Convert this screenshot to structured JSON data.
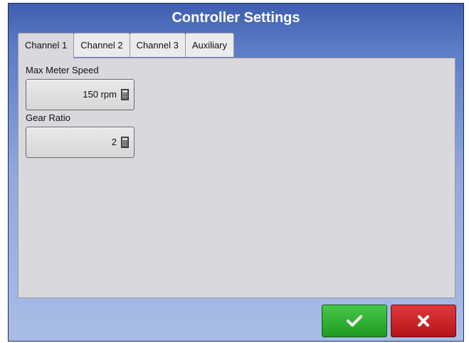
{
  "dialog": {
    "title": "Controller Settings"
  },
  "tabs": [
    {
      "label": "Channel 1",
      "active": true
    },
    {
      "label": "Channel 2",
      "active": false
    },
    {
      "label": "Channel 3",
      "active": false
    },
    {
      "label": "Auxiliary",
      "active": false
    }
  ],
  "fields": {
    "max_meter_speed": {
      "label": "Max Meter Speed",
      "value": "150 rpm",
      "icon": "calculator-icon"
    },
    "gear_ratio": {
      "label": "Gear Ratio",
      "value": "2",
      "icon": "calculator-icon"
    }
  },
  "buttons": {
    "ok": {
      "icon": "checkmark-icon",
      "color": "#2db030"
    },
    "cancel": {
      "icon": "close-icon",
      "color": "#d0242a"
    }
  },
  "colors": {
    "header_blue": "#3f5eb0",
    "panel_gray": "#d9d9dd"
  }
}
